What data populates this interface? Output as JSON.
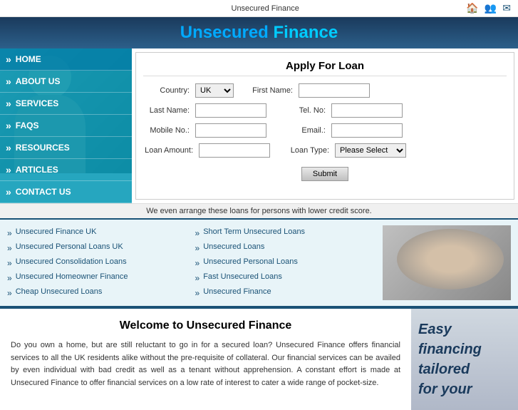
{
  "topbar": {
    "title": "Unsecured Finance",
    "icons": [
      "home-icon",
      "users-icon",
      "mail-icon"
    ]
  },
  "header": {
    "title_plain": "Unsecured ",
    "title_accent": "Finance"
  },
  "nav": {
    "items": [
      {
        "label": "HOME",
        "active": true
      },
      {
        "label": "ABOUT US",
        "active": false
      },
      {
        "label": "SERVICES",
        "active": false
      },
      {
        "label": "FAQs",
        "active": false
      },
      {
        "label": "RESOURCES",
        "active": false
      },
      {
        "label": "ARTICLES",
        "active": false
      },
      {
        "label": "CONTACT US",
        "active": false
      }
    ]
  },
  "form": {
    "title": "Apply For Loan",
    "country_label": "Country:",
    "country_default": "UK",
    "first_name_label": "First Name:",
    "last_name_label": "Last Name:",
    "tel_label": "Tel. No:",
    "mobile_label": "Mobile No.:",
    "email_label": "Email.:",
    "loan_amount_label": "Loan Amount:",
    "loan_type_label": "Loan Type:",
    "loan_type_default": "Please Select",
    "submit_label": "Submit",
    "note": "We even arrange these loans for persons with lower credit score."
  },
  "links": {
    "left": [
      "Unsecured Finance UK",
      "Unsecured Personal Loans UK",
      "Unsecured Consolidation Loans",
      "Unsecured Homeowner Finance",
      "Cheap Unsecured Loans"
    ],
    "right": [
      "Short Term Unsecured Loans",
      "Unsecured Loans",
      "Unsecured Personal Loans",
      "Fast Unsecured Loans",
      "Unsecured Finance"
    ]
  },
  "bottom": {
    "title": "Welcome to Unsecured Finance",
    "text": "Do you own a home, but are still reluctant to go in for a secured loan? Unsecured Finance offers financial services to all the UK residents alike without the pre-requisite of collateral. Our financial services can be availed by even individual with bad credit as well as a tenant without apprehension. A constant effort is made at Unsecured Finance to offer financial services on a low rate of interest to cater a wide range of pocket-size.",
    "tagline_lines": [
      "Easy",
      "financing",
      "tailored",
      "for your"
    ]
  }
}
